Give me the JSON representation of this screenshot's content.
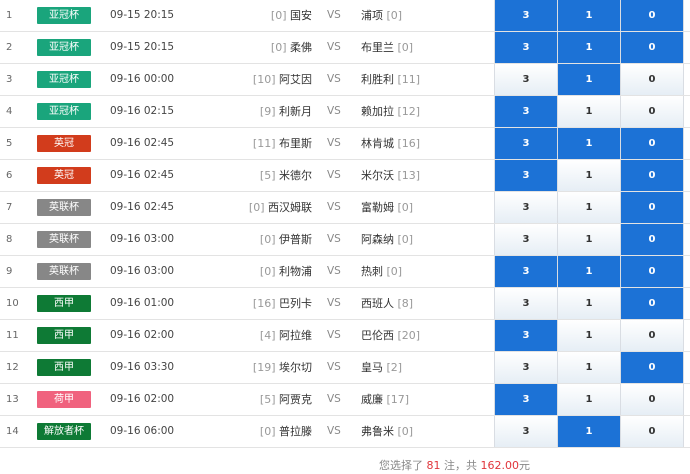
{
  "colors": {
    "selected": "#1c72d6",
    "league_afc": "#1aa57c",
    "league_epl": "#d23c1c",
    "league_efl": "#878787",
    "league_liga": "#0e7a35",
    "league_ere": "#f0627e"
  },
  "matches": [
    {
      "idx": "1",
      "league": "亚冠杯",
      "color": "#1aa57c",
      "time": "09-15 20:15",
      "home_rank": "[0]",
      "home": "国安",
      "away": "浦项",
      "away_rank": "[0]",
      "odds": [
        "3",
        "1",
        "0"
      ],
      "selected": [
        true,
        true,
        true
      ]
    },
    {
      "idx": "2",
      "league": "亚冠杯",
      "color": "#1aa57c",
      "time": "09-15 20:15",
      "home_rank": "[0]",
      "home": "柔佛",
      "away": "布里兰",
      "away_rank": "[0]",
      "odds": [
        "3",
        "1",
        "0"
      ],
      "selected": [
        true,
        true,
        true
      ]
    },
    {
      "idx": "3",
      "league": "亚冠杯",
      "color": "#1aa57c",
      "time": "09-16 00:00",
      "home_rank": "[10]",
      "home": "阿艾因",
      "away": "利胜利",
      "away_rank": "[11]",
      "odds": [
        "3",
        "1",
        "0"
      ],
      "selected": [
        false,
        true,
        false
      ]
    },
    {
      "idx": "4",
      "league": "亚冠杯",
      "color": "#1aa57c",
      "time": "09-16 02:15",
      "home_rank": "[9]",
      "home": "利新月",
      "away": "赖加拉",
      "away_rank": "[12]",
      "odds": [
        "3",
        "1",
        "0"
      ],
      "selected": [
        true,
        false,
        false
      ]
    },
    {
      "idx": "5",
      "league": "英冠",
      "color": "#d23c1c",
      "time": "09-16 02:45",
      "home_rank": "[11]",
      "home": "布里斯",
      "away": "林肯城",
      "away_rank": "[16]",
      "odds": [
        "3",
        "1",
        "0"
      ],
      "selected": [
        true,
        true,
        true
      ]
    },
    {
      "idx": "6",
      "league": "英冠",
      "color": "#d23c1c",
      "time": "09-16 02:45",
      "home_rank": "[5]",
      "home": "米德尔",
      "away": "米尔沃",
      "away_rank": "[13]",
      "odds": [
        "3",
        "1",
        "0"
      ],
      "selected": [
        true,
        false,
        true
      ]
    },
    {
      "idx": "7",
      "league": "英联杯",
      "color": "#878787",
      "time": "09-16 02:45",
      "home_rank": "[0]",
      "home": "西汉姆联",
      "away": "富勒姆",
      "away_rank": "[0]",
      "odds": [
        "3",
        "1",
        "0"
      ],
      "selected": [
        false,
        false,
        true
      ]
    },
    {
      "idx": "8",
      "league": "英联杯",
      "color": "#878787",
      "time": "09-16 03:00",
      "home_rank": "[0]",
      "home": "伊普斯",
      "away": "阿森纳",
      "away_rank": "[0]",
      "odds": [
        "3",
        "1",
        "0"
      ],
      "selected": [
        false,
        false,
        true
      ]
    },
    {
      "idx": "9",
      "league": "英联杯",
      "color": "#878787",
      "time": "09-16 03:00",
      "home_rank": "[0]",
      "home": "利物浦",
      "away": "热刺",
      "away_rank": "[0]",
      "odds": [
        "3",
        "1",
        "0"
      ],
      "selected": [
        true,
        true,
        true
      ]
    },
    {
      "idx": "10",
      "league": "西甲",
      "color": "#0e7a35",
      "time": "09-16 01:00",
      "home_rank": "[16]",
      "home": "巴列卡",
      "away": "西班人",
      "away_rank": "[8]",
      "odds": [
        "3",
        "1",
        "0"
      ],
      "selected": [
        false,
        false,
        true
      ]
    },
    {
      "idx": "11",
      "league": "西甲",
      "color": "#0e7a35",
      "time": "09-16 02:00",
      "home_rank": "[4]",
      "home": "阿拉维",
      "away": "巴伦西",
      "away_rank": "[20]",
      "odds": [
        "3",
        "1",
        "0"
      ],
      "selected": [
        true,
        false,
        false
      ]
    },
    {
      "idx": "12",
      "league": "西甲",
      "color": "#0e7a35",
      "time": "09-16 03:30",
      "home_rank": "[19]",
      "home": "埃尔切",
      "away": "皇马",
      "away_rank": "[2]",
      "odds": [
        "3",
        "1",
        "0"
      ],
      "selected": [
        false,
        false,
        true
      ]
    },
    {
      "idx": "13",
      "league": "荷甲",
      "color": "#f0627e",
      "time": "09-16 02:00",
      "home_rank": "[5]",
      "home": "阿贾克",
      "away": "威廉",
      "away_rank": "[17]",
      "odds": [
        "3",
        "1",
        "0"
      ],
      "selected": [
        true,
        false,
        false
      ]
    },
    {
      "idx": "14",
      "league": "解放者杯",
      "color": "#0e7a35",
      "time": "09-16 06:00",
      "home_rank": "[0]",
      "home": "普拉滕",
      "away": "弗鲁米",
      "away_rank": "[0]",
      "odds": [
        "3",
        "1",
        "0"
      ],
      "selected": [
        false,
        true,
        false
      ]
    }
  ],
  "vs_label": "VS",
  "summary": {
    "prefix": "您选择了",
    "count": "81",
    "middle": "注，共",
    "amount": "162.00",
    "unit": "元"
  }
}
